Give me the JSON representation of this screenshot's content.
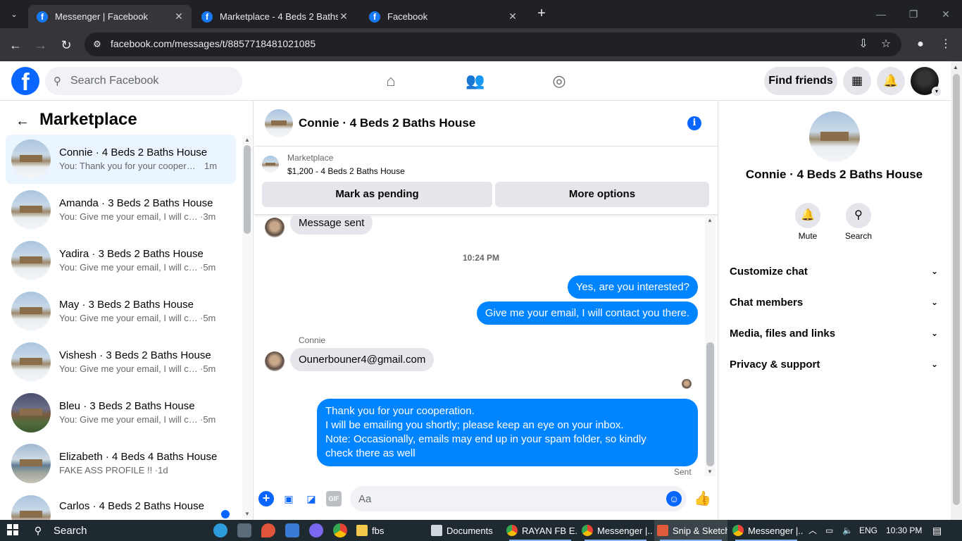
{
  "browser": {
    "tabs": [
      {
        "title": "Messenger | Facebook",
        "active": true
      },
      {
        "title": "Marketplace - 4 Beds 2 Baths H",
        "active": false
      },
      {
        "title": "Facebook",
        "active": false
      }
    ],
    "url": "facebook.com/messages/t/8857718481021085"
  },
  "header": {
    "search_placeholder": "Search Facebook",
    "find_friends": "Find friends"
  },
  "sidebar": {
    "title": "Marketplace",
    "conversations": [
      {
        "name": "Connie · 4 Beds 2 Baths House",
        "snippet": "You: Thank you for your cooperati...",
        "time": "1m"
      },
      {
        "name": "Amanda · 3 Beds 2 Baths House",
        "snippet": "You: Give me your email, I will con...",
        "time": "·3m"
      },
      {
        "name": "Yadira · 3 Beds 2 Baths House",
        "snippet": "You: Give me your email, I will con...",
        "time": "·5m"
      },
      {
        "name": "May · 3 Beds 2 Baths House",
        "snippet": "You: Give me your email, I will con...",
        "time": "·5m"
      },
      {
        "name": "Vishesh · 3 Beds 2 Baths House",
        "snippet": "You: Give me your email, I will con...",
        "time": "·5m"
      },
      {
        "name": "Bleu · 3 Beds 2 Baths House",
        "snippet": "You: Give me your email, I will con...",
        "time": "·5m"
      },
      {
        "name": "Elizabeth · 4 Beds 4 Baths House",
        "snippet": "FAKE ASS PROFILE !! ·",
        "time": "1d"
      },
      {
        "name": "Carlos · 4 Beds 2 Baths House",
        "snippet": "",
        "time": ""
      }
    ]
  },
  "chat": {
    "title": "Connie · 4 Beds 2 Baths House",
    "marketplace_label": "Marketplace",
    "listing": "$1,200 - 4 Beds 2 Baths House",
    "mark_pending": "Mark as pending",
    "more_options": "More options",
    "messages": {
      "m1": "Message sent",
      "time": "10:24 PM",
      "m2": "Yes, are you interested?",
      "m3": "Give me your email, I will contact you there.",
      "sender": "Connie",
      "m4": "Ounerbouner4@gmail.com",
      "m5_line1": "Thank you for your cooperation.",
      "m5_line2": "I will be emailing you shortly; please keep an eye on your inbox.",
      "m5_line3": "Note: Occasionally, emails may end up in your spam folder, so kindly",
      "m5_line4": "check there as well",
      "status": "Sent"
    },
    "composer_placeholder": "Aa",
    "gif_label": "GIF"
  },
  "details": {
    "name": "Connie · 4 Beds 2 Baths House",
    "mute": "Mute",
    "search": "Search",
    "sections": [
      "Customize chat",
      "Chat members",
      "Media, files and links",
      "Privacy & support"
    ]
  },
  "taskbar": {
    "search": "Search",
    "apps": [
      {
        "label": "fbs"
      },
      {
        "label": "Documents"
      },
      {
        "label": "RAYAN FB E..."
      },
      {
        "label": "Messenger |..."
      },
      {
        "label": "Snip & Sketch"
      },
      {
        "label": "Messenger |..."
      }
    ],
    "lang": "ENG",
    "clock": "10:30 PM"
  }
}
